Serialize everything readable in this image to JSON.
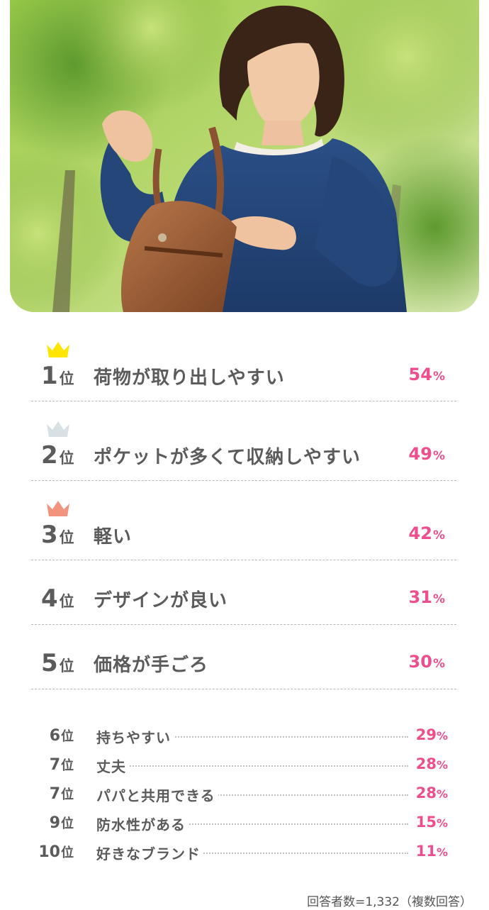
{
  "colors": {
    "accent": "#ee4e8e",
    "text": "#5b5b5b",
    "gold_crown": "#ffe600",
    "silver_crown": "#d9e0e4",
    "bronze_crown": "#f2947d"
  },
  "hero_image": {
    "icon": "photo-woman-with-brown-leather-bag"
  },
  "chart_data": {
    "type": "table",
    "rank_suffix": "位",
    "unit": "%",
    "rows": [
      {
        "rank": "1",
        "label": "荷物が取り出しやすい",
        "value": 54,
        "crown": "gold-crown-icon"
      },
      {
        "rank": "2",
        "label": "ポケットが多くて収納しやすい",
        "value": 49,
        "crown": "silver-crown-icon"
      },
      {
        "rank": "3",
        "label": "軽い",
        "value": 42,
        "crown": "bronze-crown-icon"
      },
      {
        "rank": "4",
        "label": "デザインが良い",
        "value": 31
      },
      {
        "rank": "5",
        "label": "価格が手ごろ",
        "value": 30
      },
      {
        "rank": "6",
        "label": "持ちやすい",
        "value": 29
      },
      {
        "rank": "7",
        "label": "丈夫",
        "value": 28
      },
      {
        "rank": "7",
        "label": "パパと共用できる",
        "value": 28
      },
      {
        "rank": "9",
        "label": "防水性がある",
        "value": 15
      },
      {
        "rank": "10",
        "label": "好きなブランド",
        "value": 11
      }
    ],
    "footnote": "回答者数=1,332（複数回答）"
  }
}
